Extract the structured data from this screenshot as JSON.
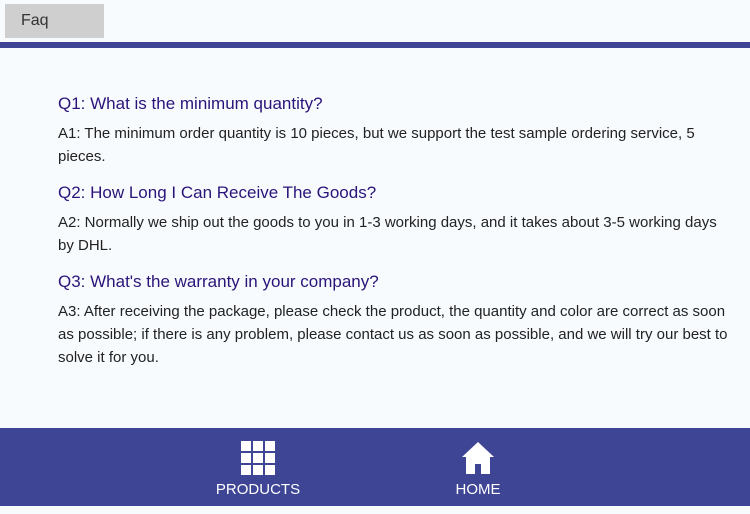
{
  "header": {
    "tab_label": "Faq"
  },
  "faq": [
    {
      "q": "Q1: What is the minimum quantity?",
      "a": "A1: The minimum order quantity is 10 pieces, but we support the test sample ordering service, 5 pieces."
    },
    {
      "q": "Q2: How Long I Can Receive The Goods?",
      "a": "A2: Normally we ship out the goods to you in 1-3 working days, and it takes about 3-5 working days by DHL."
    },
    {
      "q": "Q3: What's the warranty in your company?",
      "a": "A3: After receiving the package, please check the product, the quantity and color are correct as soon as possible; if there is any problem, please contact us as soon as possible, and we will try our best to solve it for you."
    }
  ],
  "bottom_nav": [
    {
      "label": "PRODUCTS",
      "icon": "grid-icon"
    },
    {
      "label": "HOME",
      "icon": "home-icon"
    }
  ],
  "colors": {
    "accent": "#3e4595",
    "question": "#2a1479",
    "tab_bg": "#cfcfcf"
  }
}
